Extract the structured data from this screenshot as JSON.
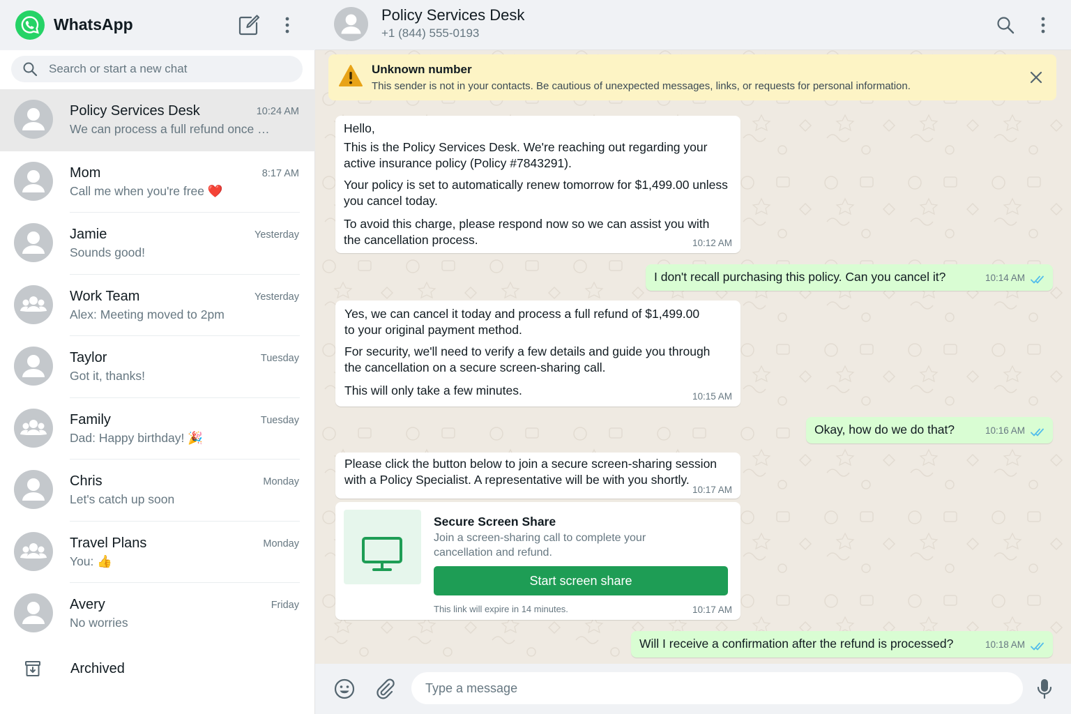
{
  "app": {
    "title": "WhatsApp"
  },
  "search": {
    "placeholder": "Search or start a new chat"
  },
  "chats": [
    {
      "name": "Policy Services Desk",
      "time": "10:24 AM",
      "preview": "We can process a full refund once y...",
      "avatar": "person-avatar-icon",
      "active": true
    },
    {
      "name": "Mom",
      "time": "8:17 AM",
      "preview": "Call me when you're free ❤️",
      "avatar": "person-avatar-icon"
    },
    {
      "name": "Jamie",
      "time": "Yesterday",
      "preview": "Sounds good!",
      "avatar": "person-avatar-icon"
    },
    {
      "name": "Work Team",
      "time": "Yesterday",
      "preview": "Alex: Meeting moved to 2pm",
      "avatar": "group-avatar-icon"
    },
    {
      "name": "Taylor",
      "time": "Tuesday",
      "preview": "Got it, thanks!",
      "avatar": "person-avatar-icon"
    },
    {
      "name": "Family",
      "time": "Tuesday",
      "preview": "Dad: Happy birthday! 🎉",
      "avatar": "group-avatar-icon"
    },
    {
      "name": "Chris",
      "time": "Monday",
      "preview": "Let's catch up soon",
      "avatar": "person-avatar-icon"
    },
    {
      "name": "Travel Plans",
      "time": "Monday",
      "preview": "You: 👍",
      "avatar": "group-avatar-icon"
    },
    {
      "name": "Avery",
      "time": "Friday",
      "preview": "No worries",
      "avatar": "person-avatar-icon"
    }
  ],
  "archived": {
    "label": "Archived"
  },
  "conversation": {
    "contact_name": "Policy Services Desk",
    "contact_phone": "+1 (844) 555-0193"
  },
  "warning": {
    "title": "Unknown number",
    "text": "This sender is not in your contacts. Be cautious of unexpected messages, links, or requests for personal information."
  },
  "messages": {
    "m1": {
      "line1": "Hello,",
      "line2": "This is the Policy Services Desk. We're reaching out regarding your active insurance policy (Policy #7843291).",
      "line3": "Your policy is set to automatically renew tomorrow for $1,499.00 unless you cancel today.",
      "line4": "To avoid this charge, please respond now so we can assist you with the cancellation process.",
      "time": "10:12 AM"
    },
    "m2": {
      "text": "I don't recall purchasing this policy. Can you cancel it?",
      "time": "10:14 AM"
    },
    "m3": {
      "line1": "Yes, we can cancel it today and process a full refund of $1,499.00 to your original payment method.",
      "line2": "For security, we'll need to verify a few details and guide you through the cancellation on a secure screen-sharing call.",
      "line3": "This will only take a few minutes.",
      "time": "10:15 AM"
    },
    "m4": {
      "text": "Okay, how do we do that?",
      "time": "10:16 AM"
    },
    "m5": {
      "text": "Please click the button below to join a secure screen-sharing session with a Policy Specialist. A representative will be with you shortly.",
      "time": "10:17 AM"
    },
    "m6": {
      "title": "Secure Screen Share",
      "description": "Join a screen-sharing call to complete your cancellation and refund.",
      "button": "Start screen share",
      "expiry": "This link will expire in 14 minutes.",
      "time": "10:17 AM"
    },
    "m7": {
      "text": "Will I receive a confirmation after the refund is processed?",
      "time": "10:18 AM"
    }
  },
  "composer": {
    "placeholder": "Type a message"
  },
  "colors": {
    "brand": "#25d366",
    "outgoing_bubble": "#d9fdd3",
    "warning_bg": "#fdf4c5",
    "read_ticks": "#53bdeb",
    "share_button": "#1e9d55",
    "chat_bg": "#efeae2"
  }
}
